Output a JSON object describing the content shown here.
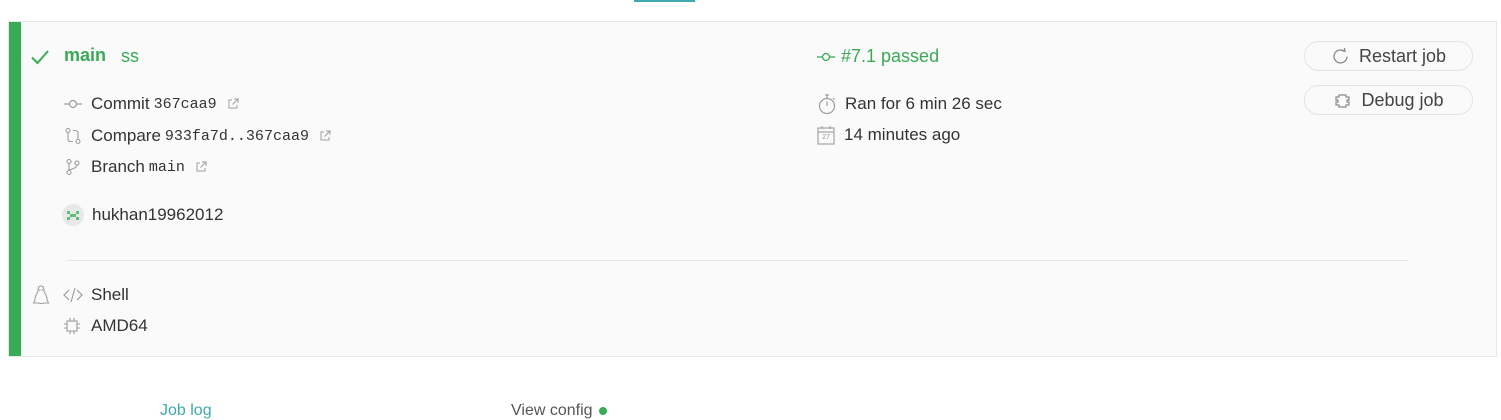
{
  "job": {
    "branch": "main",
    "message": "ss",
    "status": "#7.1 passed",
    "commit_label": "Commit",
    "commit_sha": "367caa9",
    "compare_label": "Compare",
    "compare_range": "933fa7d..367caa9",
    "branch_label": "Branch",
    "branch_name": "main",
    "author": "hukhan19962012",
    "duration": "Ran for 6 min 26 sec",
    "finished": "14 minutes ago",
    "language": "Shell",
    "arch": "AMD64"
  },
  "calendar_day": "27",
  "actions": {
    "restart": "Restart job",
    "debug": "Debug job"
  },
  "tabs": {
    "job_log": "Job log",
    "view_config": "View config"
  },
  "colors": {
    "passed": "#39aa56",
    "link": "#3eaaaf",
    "icon": "#9d9d9d"
  },
  "icons": [
    "check-icon",
    "commit-icon",
    "compare-icon",
    "branch-icon",
    "external-link-icon",
    "stopwatch-icon",
    "calendar-icon",
    "restart-icon",
    "debug-icon",
    "linux-icon",
    "code-icon",
    "cpu-icon",
    "avatar"
  ]
}
